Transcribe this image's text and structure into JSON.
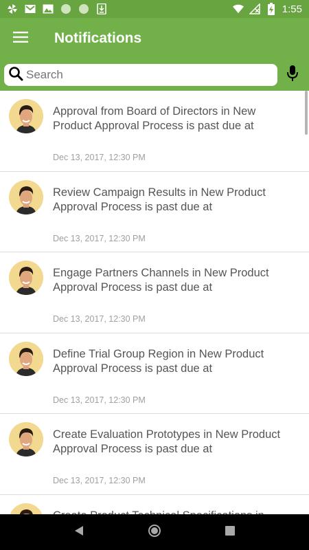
{
  "status_bar": {
    "time": "1:55",
    "icons": [
      "pinwheel-icon",
      "gmail-icon",
      "image-icon",
      "circle-icon",
      "circle-icon",
      "download-icon",
      "wifi-icon",
      "no-signal-icon",
      "battery-charging-icon"
    ]
  },
  "app_bar": {
    "title": "Notifications",
    "menu_icon": "hamburger-menu-icon"
  },
  "search": {
    "placeholder": "Search",
    "value": "",
    "mic_icon": "microphone-icon"
  },
  "colors": {
    "status_bar": "#68a541",
    "app_bar": "#72b14a",
    "item_text": "#555555",
    "date_text": "#a0a0a0"
  },
  "notifications": [
    {
      "text": "Approval from Board of Directors in New Product Approval Process is past due at",
      "date": "Dec 13, 2017, 12:30 PM"
    },
    {
      "text": "Review Campaign Results in New Product Approval Process is past due at",
      "date": "Dec 13, 2017, 12:30 PM"
    },
    {
      "text": "Engage Partners Channels in New Product Approval Process is past due at",
      "date": "Dec 13, 2017, 12:30 PM"
    },
    {
      "text": "Define Trial Group Region in New Product Approval Process is past due at",
      "date": "Dec 13, 2017, 12:30 PM"
    },
    {
      "text": "Create Evaluation Prototypes in New Product Approval Process is past due at",
      "date": "Dec 13, 2017, 12:30 PM"
    },
    {
      "text": "Create Product Technical Specifications in",
      "date": ""
    }
  ],
  "nav_bar": {
    "back_icon": "back-triangle-icon",
    "home_icon": "home-circle-icon",
    "recents_icon": "recents-square-icon"
  }
}
